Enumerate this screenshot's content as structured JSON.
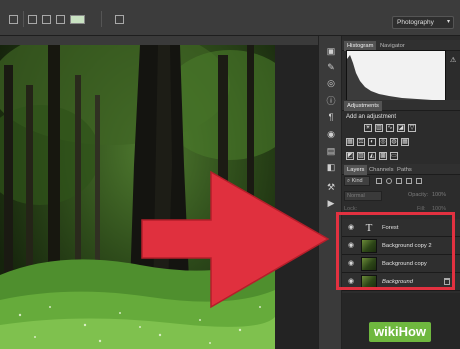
{
  "workspace": {
    "selected": "Photography"
  },
  "panels": {
    "top_tabs": [
      "Histogram",
      "Navigator"
    ],
    "adjustments": {
      "tab": "Adjustments",
      "title": "Add an adjustment"
    },
    "layers_tabs": [
      "Layers",
      "Channels",
      "Paths"
    ],
    "kind_filter": "Kind",
    "blend_mode": "Normal",
    "opacity": {
      "label": "Opacity:",
      "value": "100%"
    },
    "lock_label": "Lock:",
    "fill": {
      "label": "Fill:",
      "value": "100%"
    }
  },
  "layers": [
    {
      "name": "Forest",
      "kind": "text"
    },
    {
      "name": "Background copy 2",
      "kind": "image"
    },
    {
      "name": "Background copy",
      "kind": "image"
    },
    {
      "name": "Background",
      "kind": "image",
      "locked": true,
      "italic": true
    }
  ],
  "annotation": {
    "arrow_color": "#e0303e",
    "box_color": "#e23140"
  },
  "watermark": {
    "text": "wikiHow",
    "color": "#6fb83f"
  }
}
